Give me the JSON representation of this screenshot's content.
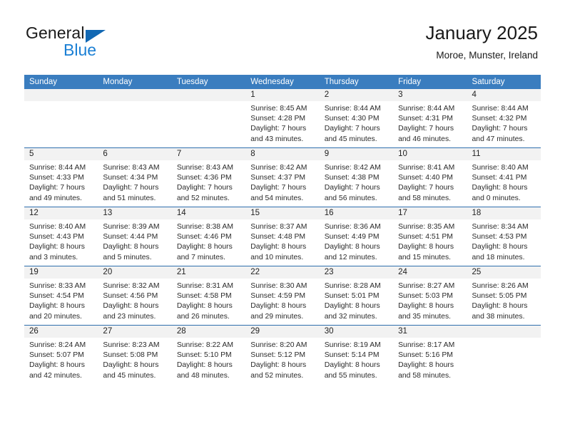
{
  "brand": {
    "name_top": "General",
    "name_bottom": "Blue",
    "accent_color": "#1268b3",
    "blue_text_color": "#1a7fd4"
  },
  "header": {
    "title": "January 2025",
    "location": "Moroe, Munster, Ireland"
  },
  "theme": {
    "header_row_bg": "#3a7dbf",
    "header_row_text": "#ffffff",
    "daynum_bg": "#f2f2f2",
    "row_divider": "#2f6fae",
    "body_text": "#2a2a2a"
  },
  "weekdays": [
    "Sunday",
    "Monday",
    "Tuesday",
    "Wednesday",
    "Thursday",
    "Friday",
    "Saturday"
  ],
  "weeks": [
    [
      {
        "day": "",
        "lines": []
      },
      {
        "day": "",
        "lines": []
      },
      {
        "day": "",
        "lines": []
      },
      {
        "day": "1",
        "lines": [
          "Sunrise: 8:45 AM",
          "Sunset: 4:28 PM",
          "Daylight: 7 hours",
          "and 43 minutes."
        ]
      },
      {
        "day": "2",
        "lines": [
          "Sunrise: 8:44 AM",
          "Sunset: 4:30 PM",
          "Daylight: 7 hours",
          "and 45 minutes."
        ]
      },
      {
        "day": "3",
        "lines": [
          "Sunrise: 8:44 AM",
          "Sunset: 4:31 PM",
          "Daylight: 7 hours",
          "and 46 minutes."
        ]
      },
      {
        "day": "4",
        "lines": [
          "Sunrise: 8:44 AM",
          "Sunset: 4:32 PM",
          "Daylight: 7 hours",
          "and 47 minutes."
        ]
      }
    ],
    [
      {
        "day": "5",
        "lines": [
          "Sunrise: 8:44 AM",
          "Sunset: 4:33 PM",
          "Daylight: 7 hours",
          "and 49 minutes."
        ]
      },
      {
        "day": "6",
        "lines": [
          "Sunrise: 8:43 AM",
          "Sunset: 4:34 PM",
          "Daylight: 7 hours",
          "and 51 minutes."
        ]
      },
      {
        "day": "7",
        "lines": [
          "Sunrise: 8:43 AM",
          "Sunset: 4:36 PM",
          "Daylight: 7 hours",
          "and 52 minutes."
        ]
      },
      {
        "day": "8",
        "lines": [
          "Sunrise: 8:42 AM",
          "Sunset: 4:37 PM",
          "Daylight: 7 hours",
          "and 54 minutes."
        ]
      },
      {
        "day": "9",
        "lines": [
          "Sunrise: 8:42 AM",
          "Sunset: 4:38 PM",
          "Daylight: 7 hours",
          "and 56 minutes."
        ]
      },
      {
        "day": "10",
        "lines": [
          "Sunrise: 8:41 AM",
          "Sunset: 4:40 PM",
          "Daylight: 7 hours",
          "and 58 minutes."
        ]
      },
      {
        "day": "11",
        "lines": [
          "Sunrise: 8:40 AM",
          "Sunset: 4:41 PM",
          "Daylight: 8 hours",
          "and 0 minutes."
        ]
      }
    ],
    [
      {
        "day": "12",
        "lines": [
          "Sunrise: 8:40 AM",
          "Sunset: 4:43 PM",
          "Daylight: 8 hours",
          "and 3 minutes."
        ]
      },
      {
        "day": "13",
        "lines": [
          "Sunrise: 8:39 AM",
          "Sunset: 4:44 PM",
          "Daylight: 8 hours",
          "and 5 minutes."
        ]
      },
      {
        "day": "14",
        "lines": [
          "Sunrise: 8:38 AM",
          "Sunset: 4:46 PM",
          "Daylight: 8 hours",
          "and 7 minutes."
        ]
      },
      {
        "day": "15",
        "lines": [
          "Sunrise: 8:37 AM",
          "Sunset: 4:48 PM",
          "Daylight: 8 hours",
          "and 10 minutes."
        ]
      },
      {
        "day": "16",
        "lines": [
          "Sunrise: 8:36 AM",
          "Sunset: 4:49 PM",
          "Daylight: 8 hours",
          "and 12 minutes."
        ]
      },
      {
        "day": "17",
        "lines": [
          "Sunrise: 8:35 AM",
          "Sunset: 4:51 PM",
          "Daylight: 8 hours",
          "and 15 minutes."
        ]
      },
      {
        "day": "18",
        "lines": [
          "Sunrise: 8:34 AM",
          "Sunset: 4:53 PM",
          "Daylight: 8 hours",
          "and 18 minutes."
        ]
      }
    ],
    [
      {
        "day": "19",
        "lines": [
          "Sunrise: 8:33 AM",
          "Sunset: 4:54 PM",
          "Daylight: 8 hours",
          "and 20 minutes."
        ]
      },
      {
        "day": "20",
        "lines": [
          "Sunrise: 8:32 AM",
          "Sunset: 4:56 PM",
          "Daylight: 8 hours",
          "and 23 minutes."
        ]
      },
      {
        "day": "21",
        "lines": [
          "Sunrise: 8:31 AM",
          "Sunset: 4:58 PM",
          "Daylight: 8 hours",
          "and 26 minutes."
        ]
      },
      {
        "day": "22",
        "lines": [
          "Sunrise: 8:30 AM",
          "Sunset: 4:59 PM",
          "Daylight: 8 hours",
          "and 29 minutes."
        ]
      },
      {
        "day": "23",
        "lines": [
          "Sunrise: 8:28 AM",
          "Sunset: 5:01 PM",
          "Daylight: 8 hours",
          "and 32 minutes."
        ]
      },
      {
        "day": "24",
        "lines": [
          "Sunrise: 8:27 AM",
          "Sunset: 5:03 PM",
          "Daylight: 8 hours",
          "and 35 minutes."
        ]
      },
      {
        "day": "25",
        "lines": [
          "Sunrise: 8:26 AM",
          "Sunset: 5:05 PM",
          "Daylight: 8 hours",
          "and 38 minutes."
        ]
      }
    ],
    [
      {
        "day": "26",
        "lines": [
          "Sunrise: 8:24 AM",
          "Sunset: 5:07 PM",
          "Daylight: 8 hours",
          "and 42 minutes."
        ]
      },
      {
        "day": "27",
        "lines": [
          "Sunrise: 8:23 AM",
          "Sunset: 5:08 PM",
          "Daylight: 8 hours",
          "and 45 minutes."
        ]
      },
      {
        "day": "28",
        "lines": [
          "Sunrise: 8:22 AM",
          "Sunset: 5:10 PM",
          "Daylight: 8 hours",
          "and 48 minutes."
        ]
      },
      {
        "day": "29",
        "lines": [
          "Sunrise: 8:20 AM",
          "Sunset: 5:12 PM",
          "Daylight: 8 hours",
          "and 52 minutes."
        ]
      },
      {
        "day": "30",
        "lines": [
          "Sunrise: 8:19 AM",
          "Sunset: 5:14 PM",
          "Daylight: 8 hours",
          "and 55 minutes."
        ]
      },
      {
        "day": "31",
        "lines": [
          "Sunrise: 8:17 AM",
          "Sunset: 5:16 PM",
          "Daylight: 8 hours",
          "and 58 minutes."
        ]
      },
      {
        "day": "",
        "lines": []
      }
    ]
  ]
}
